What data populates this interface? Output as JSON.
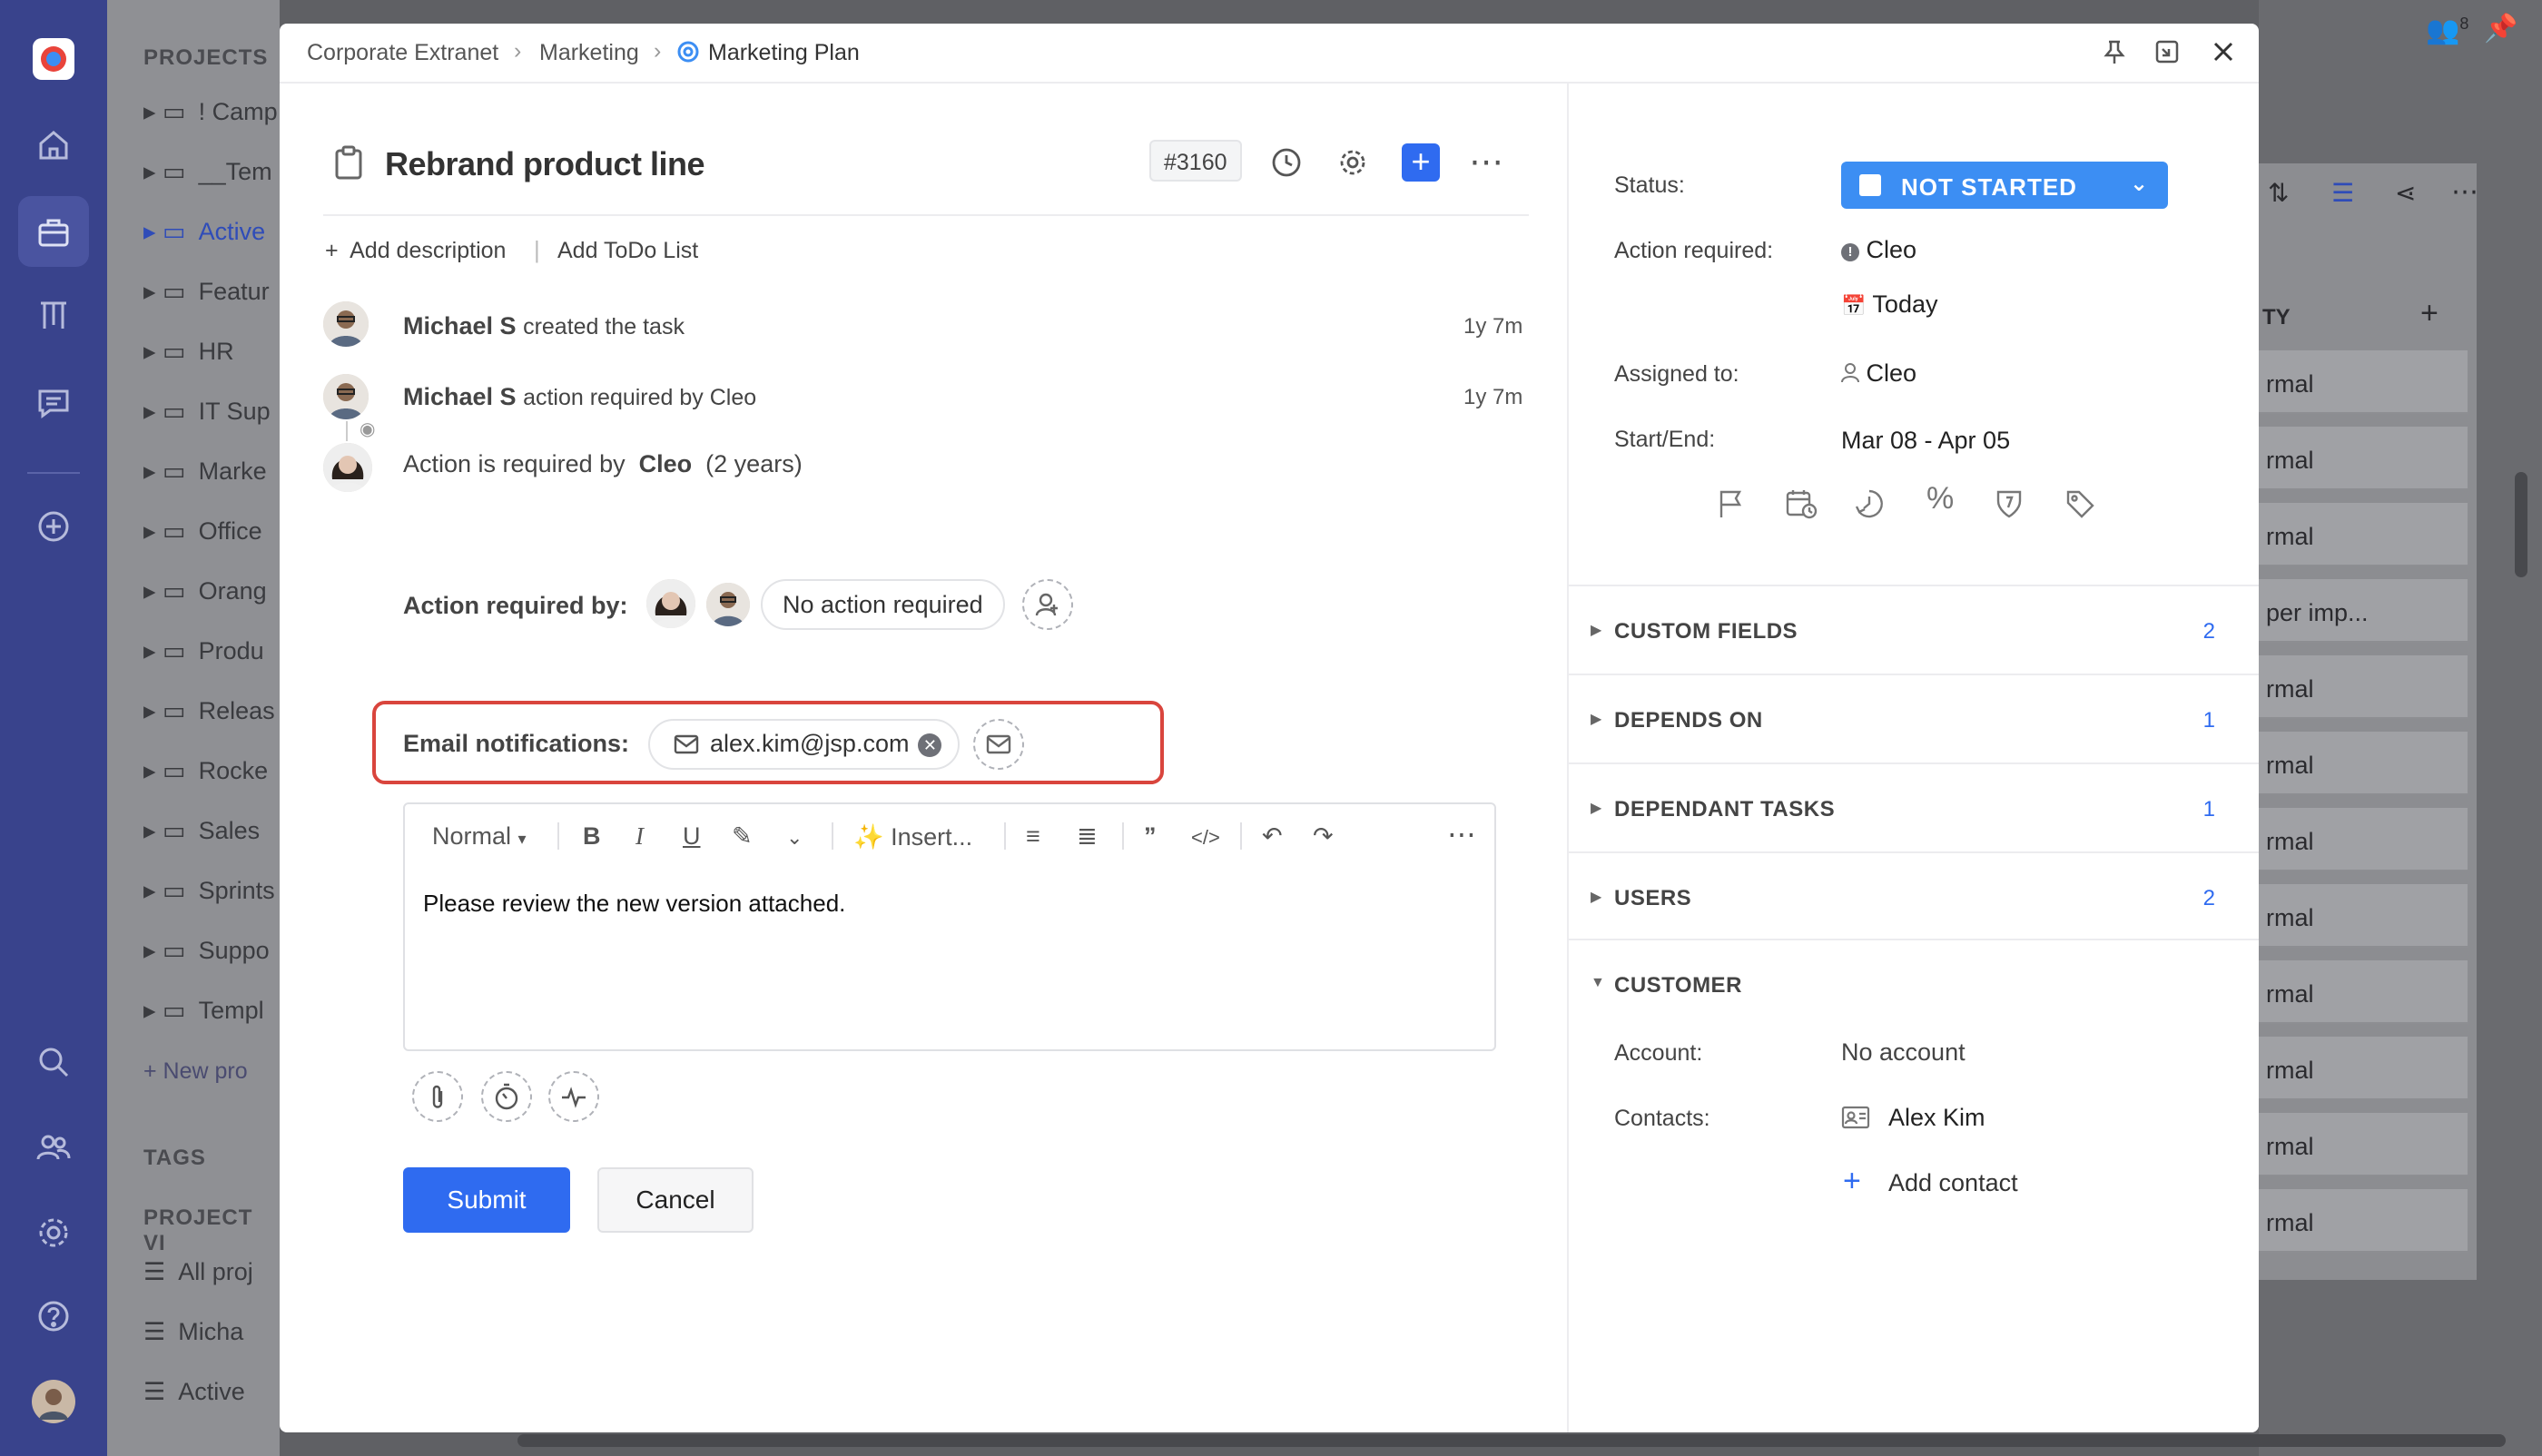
{
  "rail": {
    "icons": [
      "app-logo-icon",
      "home-icon",
      "briefcase-icon",
      "board-icon",
      "chat-icon",
      "add-circle-icon",
      "search-icon",
      "users-icon",
      "settings-icon",
      "help-icon",
      "user-avatar"
    ]
  },
  "bg_projects": {
    "section_projects": "PROJECTS",
    "items": [
      "! Camp",
      "__Tem",
      "Active",
      "Featur",
      "HR",
      "IT Sup",
      "Marke",
      "Office",
      "Orang",
      "Produ",
      "Releas",
      "Rocke",
      "Sales",
      "Sprints",
      "Suppo",
      "Templ"
    ],
    "new_project": "+ New pro",
    "section_tags": "TAGS",
    "section_views": "PROJECT VI",
    "views": [
      "All proj",
      "Micha",
      "Active"
    ]
  },
  "bg_right": {
    "col_header": "TY",
    "rows": [
      "rmal",
      "rmal",
      "rmal",
      "per imp...",
      "rmal",
      "rmal",
      "rmal",
      "rmal",
      "rmal",
      "rmal",
      "rmal",
      "rmal"
    ],
    "user_count": "8"
  },
  "breadcrumb": {
    "item1": "Corporate Extranet",
    "item2": "Marketing",
    "item3": "Marketing Plan"
  },
  "task": {
    "title": "Rebrand product line",
    "id": "#3160",
    "add_description": "Add description",
    "add_todo": "Add ToDo List"
  },
  "activity": [
    {
      "user": "Michael S",
      "text": "created the task",
      "time": "1y 7m"
    },
    {
      "user": "Michael S",
      "text": "action required by Cleo",
      "time": "1y 7m"
    }
  ],
  "action_notice": {
    "prefix": "Action is required by",
    "user": "Cleo",
    "suffix": "(2 years)"
  },
  "action_required_by": {
    "label": "Action required by:",
    "chip": "No action required"
  },
  "email_notifications": {
    "label": "Email notifications:",
    "email": "alex.kim@jsp.com"
  },
  "editor": {
    "format": "Normal",
    "insert": "Insert...",
    "content": "Please review the new version attached."
  },
  "buttons": {
    "submit": "Submit",
    "cancel": "Cancel"
  },
  "details": {
    "status_label": "Status:",
    "status_value": "NOT STARTED",
    "action_label": "Action required:",
    "action_user": "Cleo",
    "action_date": "Today",
    "assigned_label": "Assigned to:",
    "assigned_user": "Cleo",
    "startend_label": "Start/End:",
    "startend_value": "Mar 08 - Apr 05"
  },
  "sections": [
    {
      "title": "CUSTOM FIELDS",
      "count": "2"
    },
    {
      "title": "DEPENDS ON",
      "count": "1"
    },
    {
      "title": "DEPENDANT TASKS",
      "count": "1"
    },
    {
      "title": "USERS",
      "count": "2"
    }
  ],
  "customer": {
    "title": "CUSTOMER",
    "account_label": "Account:",
    "account_value": "No account",
    "contacts_label": "Contacts:",
    "contact_name": "Alex Kim",
    "add_contact": "Add contact"
  },
  "colors": {
    "accent": "#2f6bf0",
    "status": "#3c8ef3",
    "highlight": "#d9453d",
    "rail": "#39438c"
  }
}
